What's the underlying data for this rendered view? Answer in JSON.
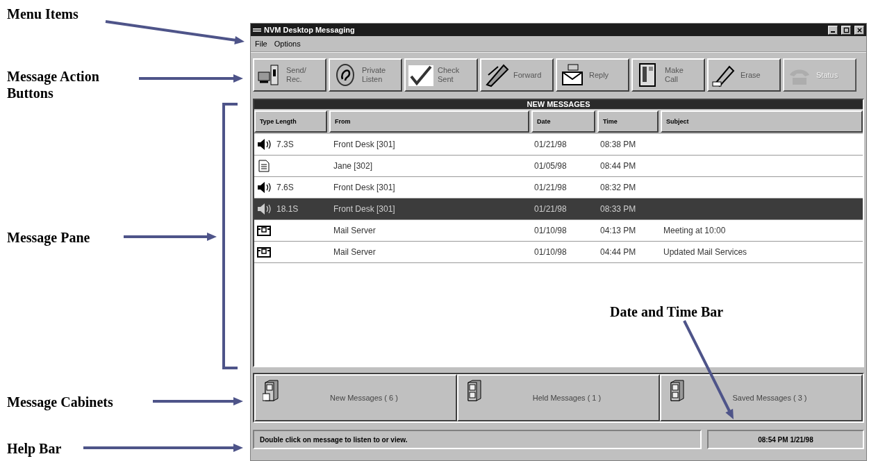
{
  "annotations": [
    {
      "label": "Menu Items"
    },
    {
      "label": "Message Action Buttons"
    },
    {
      "label": "Message Pane"
    },
    {
      "label": "Date and Time Bar"
    },
    {
      "label": "Message Cabinets"
    },
    {
      "label": "Help Bar"
    }
  ],
  "window": {
    "title": "NVM Desktop Messaging"
  },
  "menu": [
    "File",
    "Options"
  ],
  "toolbar": [
    {
      "label": "Send/ Rec.",
      "kind": "send",
      "disabled": false
    },
    {
      "label": "Private Listen",
      "kind": "listen",
      "disabled": false
    },
    {
      "label": "Check Sent",
      "kind": "check",
      "disabled": false
    },
    {
      "label": "Forward",
      "kind": "forward",
      "disabled": false
    },
    {
      "label": "Reply",
      "kind": "reply",
      "disabled": false
    },
    {
      "label": "Make Call",
      "kind": "call",
      "disabled": false
    },
    {
      "label": "Erase",
      "kind": "erase",
      "disabled": false
    },
    {
      "label": "Status",
      "kind": "status",
      "disabled": true
    }
  ],
  "pane": {
    "title": "NEW MESSAGES",
    "columns": [
      "Type Length",
      "From",
      "Date",
      "Time",
      "Subject"
    ],
    "rows": [
      {
        "kind": "voice",
        "length": "7.3S",
        "from": "Front Desk [301]",
        "date": "01/21/98",
        "time": "08:38 PM",
        "selected": false
      },
      {
        "kind": "document",
        "from": "Jane [302]",
        "date": "01/05/98",
        "time": "08:44 PM",
        "selected": false
      },
      {
        "kind": "voice",
        "length": "7.6S",
        "from": "Front Desk [301]",
        "date": "01/21/98",
        "time": "08:32 PM",
        "selected": false
      },
      {
        "kind": "voice",
        "length": "18.1S",
        "from": "Front Desk [301]",
        "date": "01/21/98",
        "time": "08:33 PM",
        "selected": true
      },
      {
        "kind": "mail",
        "from": "Mail Server",
        "date": "01/10/98",
        "time": "04:13 PM",
        "subject": "Meeting at 10:00",
        "selected": false
      },
      {
        "kind": "mail",
        "from": "Mail Server",
        "date": "01/10/98",
        "time": "04:44 PM",
        "subject": "Updated Mail Services",
        "selected": false
      }
    ]
  },
  "cabinets": [
    {
      "label": "New Messages ( 6 )",
      "open": true
    },
    {
      "label": "Held Messages ( 1 )",
      "open": false
    },
    {
      "label": "Saved Messages ( 3 )",
      "open": false
    }
  ],
  "status_bar": {
    "help": "Double click on message to listen to or view.",
    "datetime": "08:54 PM 1/21/98"
  }
}
